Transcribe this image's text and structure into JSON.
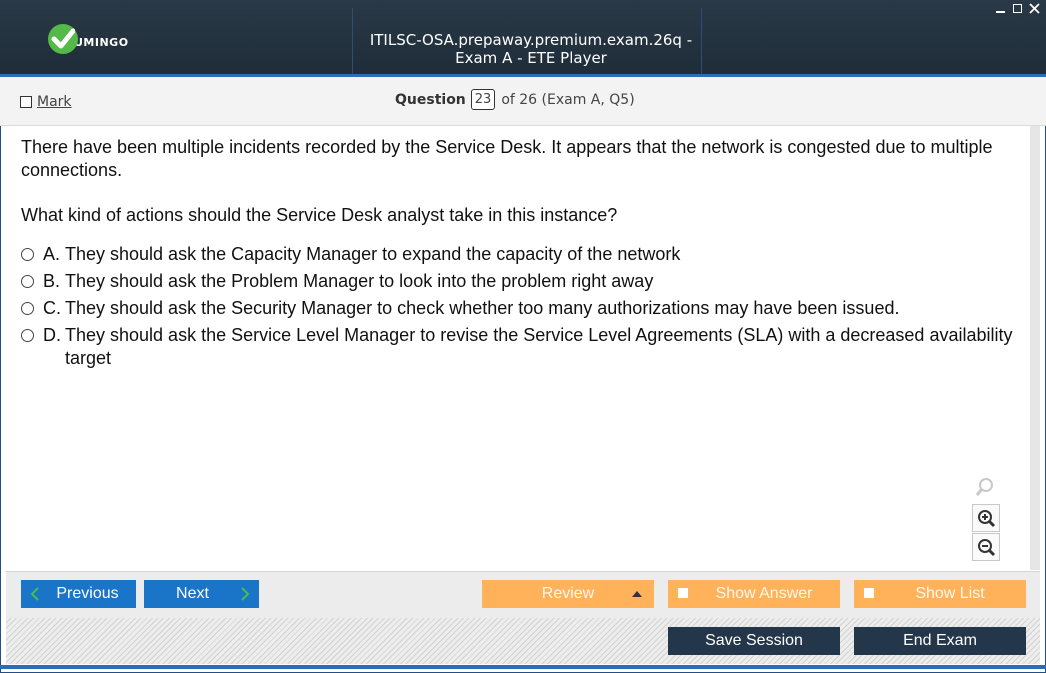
{
  "app": {
    "logo_text": "UMINGO",
    "window_title": "ITILSC-OSA.prepaway.premium.exam.26q - Exam A - ETE Player"
  },
  "header": {
    "mark_label": "Mark",
    "question_label": "Question",
    "question_number": "23",
    "question_of": "of 26 (Exam A, Q5)"
  },
  "question": {
    "paragraph1": "There have been multiple incidents recorded by the Service Desk. It appears that the network is congested due to multiple connections.",
    "paragraph2": "What kind of actions should the Service Desk analyst take in this instance?",
    "answers": [
      {
        "letter": "A.",
        "text": "They should ask the Capacity Manager to expand the capacity of the network"
      },
      {
        "letter": "B.",
        "text": "They should ask the Problem Manager to look into the problem right away"
      },
      {
        "letter": "C.",
        "text": "They should ask the Security Manager to check whether too many authorizations may have been issued."
      },
      {
        "letter": "D.",
        "text": "They should ask the Service Level Manager to revise the Service Level Agreements (SLA) with a decreased availability target"
      }
    ]
  },
  "nav": {
    "previous_label": "Previous",
    "next_label": "Next",
    "review_label": "Review",
    "show_answer_label": "Show Answer",
    "show_list_label": "Show List",
    "save_session_label": "Save Session",
    "end_exam_label": "End Exam"
  },
  "icons": [
    "check-logo-icon",
    "minimize-icon",
    "maximize-icon",
    "close-icon",
    "search-icon",
    "zoom-in-icon",
    "zoom-out-icon",
    "chevron-left-icon",
    "chevron-right-icon",
    "triangle-up-icon"
  ],
  "colors": {
    "titlebar": "#23323f",
    "accent_blue": "#1a75c8",
    "orange": "#ffb25a",
    "dark_button": "#23364a",
    "logo_green": "#54b948"
  }
}
